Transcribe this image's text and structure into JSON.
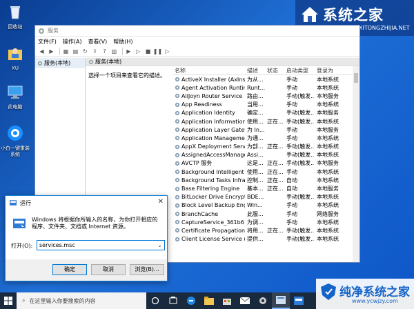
{
  "desktop": {
    "icons": [
      {
        "label": "回收站"
      },
      {
        "label": "XU"
      },
      {
        "label": "此电脑"
      },
      {
        "label": "小白一键重装系统"
      }
    ]
  },
  "watermark_top": {
    "title": "系统之家",
    "url": "XITONGZHIJIA.NET"
  },
  "services_window": {
    "title": "服务",
    "menu": [
      "文件(F)",
      "操作(A)",
      "查看(V)",
      "帮助(H)"
    ],
    "tree_item": "服务(本地)",
    "header": "服务(本地)",
    "description_hint": "选择一个项目来查看它的描述。",
    "columns": {
      "name": "名称",
      "desc": "描述",
      "status": "状态",
      "startup": "启动类型",
      "logon": "登录为"
    },
    "rows": [
      {
        "name": "ActiveX Installer (AxInstSV)",
        "desc": "为从...",
        "status": "",
        "startup": "手动",
        "logon": "本地系统"
      },
      {
        "name": "Agent Activation Runtime...",
        "desc": "Runt...",
        "status": "",
        "startup": "手动",
        "logon": "本地系统"
      },
      {
        "name": "AllJoyn Router Service",
        "desc": "路由...",
        "status": "",
        "startup": "手动(触发...",
        "logon": "本地服务"
      },
      {
        "name": "App Readiness",
        "desc": "当用...",
        "status": "",
        "startup": "手动",
        "logon": "本地系统"
      },
      {
        "name": "Application Identity",
        "desc": "确定...",
        "status": "",
        "startup": "手动(触发...",
        "logon": "本地服务"
      },
      {
        "name": "Application Information",
        "desc": "使用...",
        "status": "正在...",
        "startup": "手动(触发...",
        "logon": "本地系统"
      },
      {
        "name": "Application Layer Gatewa...",
        "desc": "为 In...",
        "status": "",
        "startup": "手动",
        "logon": "本地服务"
      },
      {
        "name": "Application Management",
        "desc": "为通...",
        "status": "",
        "startup": "手动",
        "logon": "本地系统"
      },
      {
        "name": "AppX Deployment Servic...",
        "desc": "为部...",
        "status": "正在...",
        "startup": "手动(触发...",
        "logon": "本地系统"
      },
      {
        "name": "AssignedAccessManager...",
        "desc": "Assi...",
        "status": "",
        "startup": "手动(触发...",
        "logon": "本地系统"
      },
      {
        "name": "AVCTP 服务",
        "desc": "这是...",
        "status": "正在...",
        "startup": "手动(触发...",
        "logon": "本地服务"
      },
      {
        "name": "Background Intelligent T...",
        "desc": "使用...",
        "status": "正在...",
        "startup": "手动",
        "logon": "本地系统"
      },
      {
        "name": "Background Tasks Infras...",
        "desc": "控制...",
        "status": "正在...",
        "startup": "自动",
        "logon": "本地系统"
      },
      {
        "name": "Base Filtering Engine",
        "desc": "基本...",
        "status": "正在...",
        "startup": "自动",
        "logon": "本地服务"
      },
      {
        "name": "BitLocker Drive Encryptio...",
        "desc": "BDE...",
        "status": "",
        "startup": "手动(触发...",
        "logon": "本地系统"
      },
      {
        "name": "Block Level Backup Engi...",
        "desc": "Win...",
        "status": "",
        "startup": "手动",
        "logon": "本地系统"
      },
      {
        "name": "BranchCache",
        "desc": "此服...",
        "status": "",
        "startup": "手动",
        "logon": "网络服务"
      },
      {
        "name": "CaptureService_361b6",
        "desc": "为调...",
        "status": "",
        "startup": "手动",
        "logon": "本地系统"
      },
      {
        "name": "Certificate Propagation",
        "desc": "将用...",
        "status": "正在...",
        "startup": "手动(触发...",
        "logon": "本地系统"
      },
      {
        "name": "Client License Service (C...",
        "desc": "提供...",
        "status": "",
        "startup": "手动(触发...",
        "logon": "本地系统"
      }
    ]
  },
  "run_dialog": {
    "title": "运行",
    "close": "✕",
    "instruction": "Windows 将根据你所输入的名称，为你打开相应的程序、文件夹、文档或 Internet 资源。",
    "open_label": "打开(O):",
    "input_value": "services.msc",
    "ok": "确定",
    "cancel": "取消",
    "browse": "浏览(B)..."
  },
  "taskbar": {
    "search_placeholder": "在这里输入你要搜索的内容"
  },
  "watermark_bottom": {
    "title": "纯净系统之家",
    "url": "www.ycwjzy.com"
  }
}
